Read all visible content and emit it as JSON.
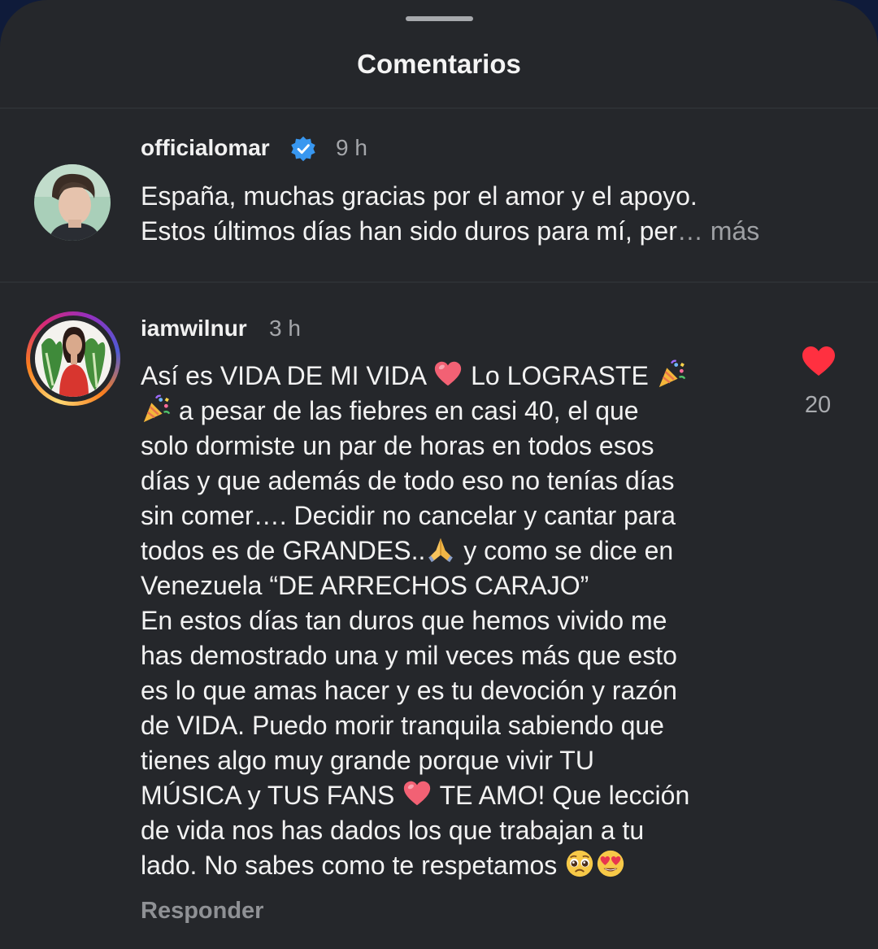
{
  "sheet": {
    "title": "Comentarios"
  },
  "comments": [
    {
      "username": "officialomar",
      "verified": true,
      "time": "9 h",
      "lines": [
        "España, muchas gracias por el amor y el apoyo.",
        "Estos últimos días han sido duros para mí, per"
      ],
      "ellipsis": "…",
      "more_label": "más"
    },
    {
      "username": "iamwilnur",
      "has_story_ring": true,
      "time": "3 h",
      "text_parts": {
        "l1a": "Así es VIDA DE MI VIDA ",
        "l1b": " Lo LOGRASTE ",
        "l2": " a pesar de las fiebres en casi 40, el que",
        "l3": "solo dormiste un par de horas en todos esos",
        "l4": "días y que además de todo eso no tenías días",
        "l5": "sin comer…. Decidir no cancelar y cantar para",
        "l6a": "todos es de GRANDES..",
        "l6b": " y como se dice en",
        "l7": "Venezuela “DE ARRECHOS CARAJO”",
        "l8": "En estos días tan duros que hemos vivido me",
        "l9": "has demostrado una y mil veces más que esto",
        "l10": "es lo que amas hacer y es tu devoción y razón",
        "l11": "de VIDA. Puedo morir tranquila sabiendo que",
        "l12": "tienes algo muy grande porque vivir TU",
        "l13a": "MÚSICA y TUS FANS ",
        "l13b": " TE AMO! Que lección",
        "l14": "de vida nos has dados los que trabajan a tu",
        "l15": "lado. No sabes como te respetamos "
      },
      "emoji_names": [
        "heart-emoji",
        "party-popper-emoji",
        "party-popper-emoji",
        "folded-hands-emoji",
        "heart-emoji",
        "pleading-face-emoji",
        "heart-eyes-emoji"
      ],
      "likes": "20",
      "liked": true,
      "reply_label": "Responder"
    }
  ],
  "colors": {
    "background": "#25272b",
    "text": "#f2f2f2",
    "secondary_text": "#a4a6aa",
    "verified": "#3897f0",
    "like": "#ff3040"
  }
}
